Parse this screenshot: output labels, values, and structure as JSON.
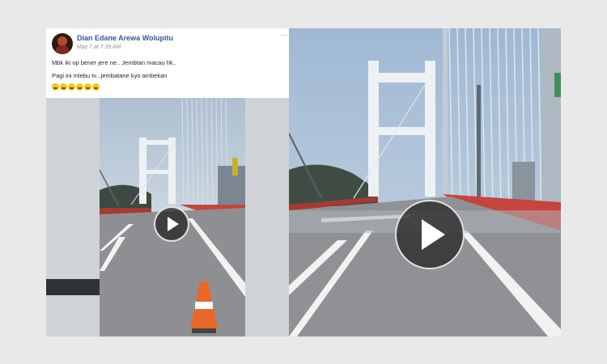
{
  "post": {
    "author": "Dian Edane Arewa Wolupitu",
    "timestamp": "May 7 at 7:39 AM",
    "line1": "Mbk iki op bener jere ne.. Jembtan macau hk..",
    "line2": "Pagi ini mlebu tv...jembatane kyo ambekan",
    "reaction_emojis": [
      "emoji-sad",
      "emoji-sad",
      "emoji-sad",
      "emoji-sad",
      "emoji-sad",
      "emoji-sad"
    ],
    "more_glyph": "···"
  },
  "video_left": {
    "play_icon": "play-icon"
  },
  "video_right": {
    "play_icon": "play-icon"
  },
  "colors": {
    "link": "#385898",
    "muted": "#90949c",
    "bridge_barrier": "#c7443c",
    "cone": "#e8682a"
  }
}
